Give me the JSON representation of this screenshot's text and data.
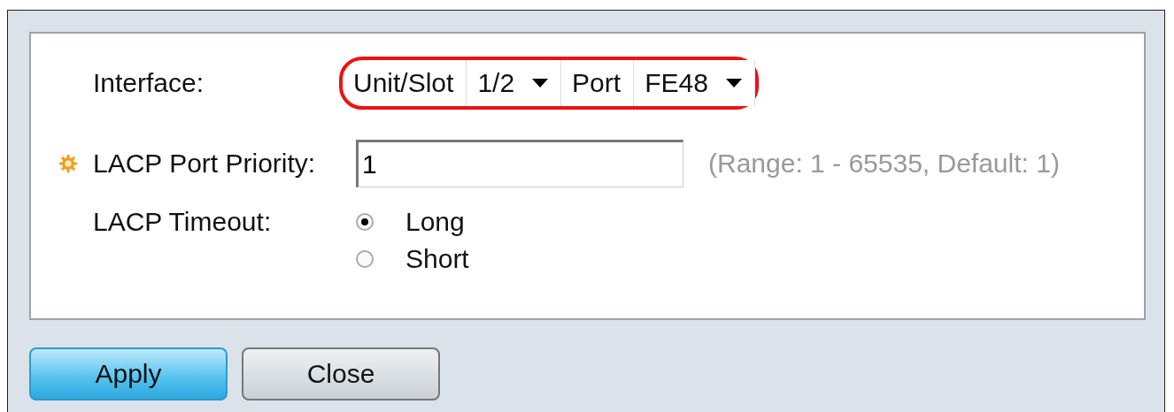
{
  "interface": {
    "label": "Interface:",
    "highlighted": true,
    "unit_slot": {
      "label": "Unit/Slot",
      "value": "1/2"
    },
    "port": {
      "label": "Port",
      "value": "FE48"
    }
  },
  "priority": {
    "label": "LACP Port Priority:",
    "required": true,
    "value": "1",
    "hint": "(Range: 1 - 65535, Default: 1)"
  },
  "timeout": {
    "label": "LACP Timeout:",
    "options": [
      {
        "label": "Long",
        "selected": true
      },
      {
        "label": "Short",
        "selected": false
      }
    ]
  },
  "buttons": [
    {
      "label": "Apply",
      "kind": "primary"
    },
    {
      "label": "Close",
      "kind": "secondary"
    }
  ]
}
